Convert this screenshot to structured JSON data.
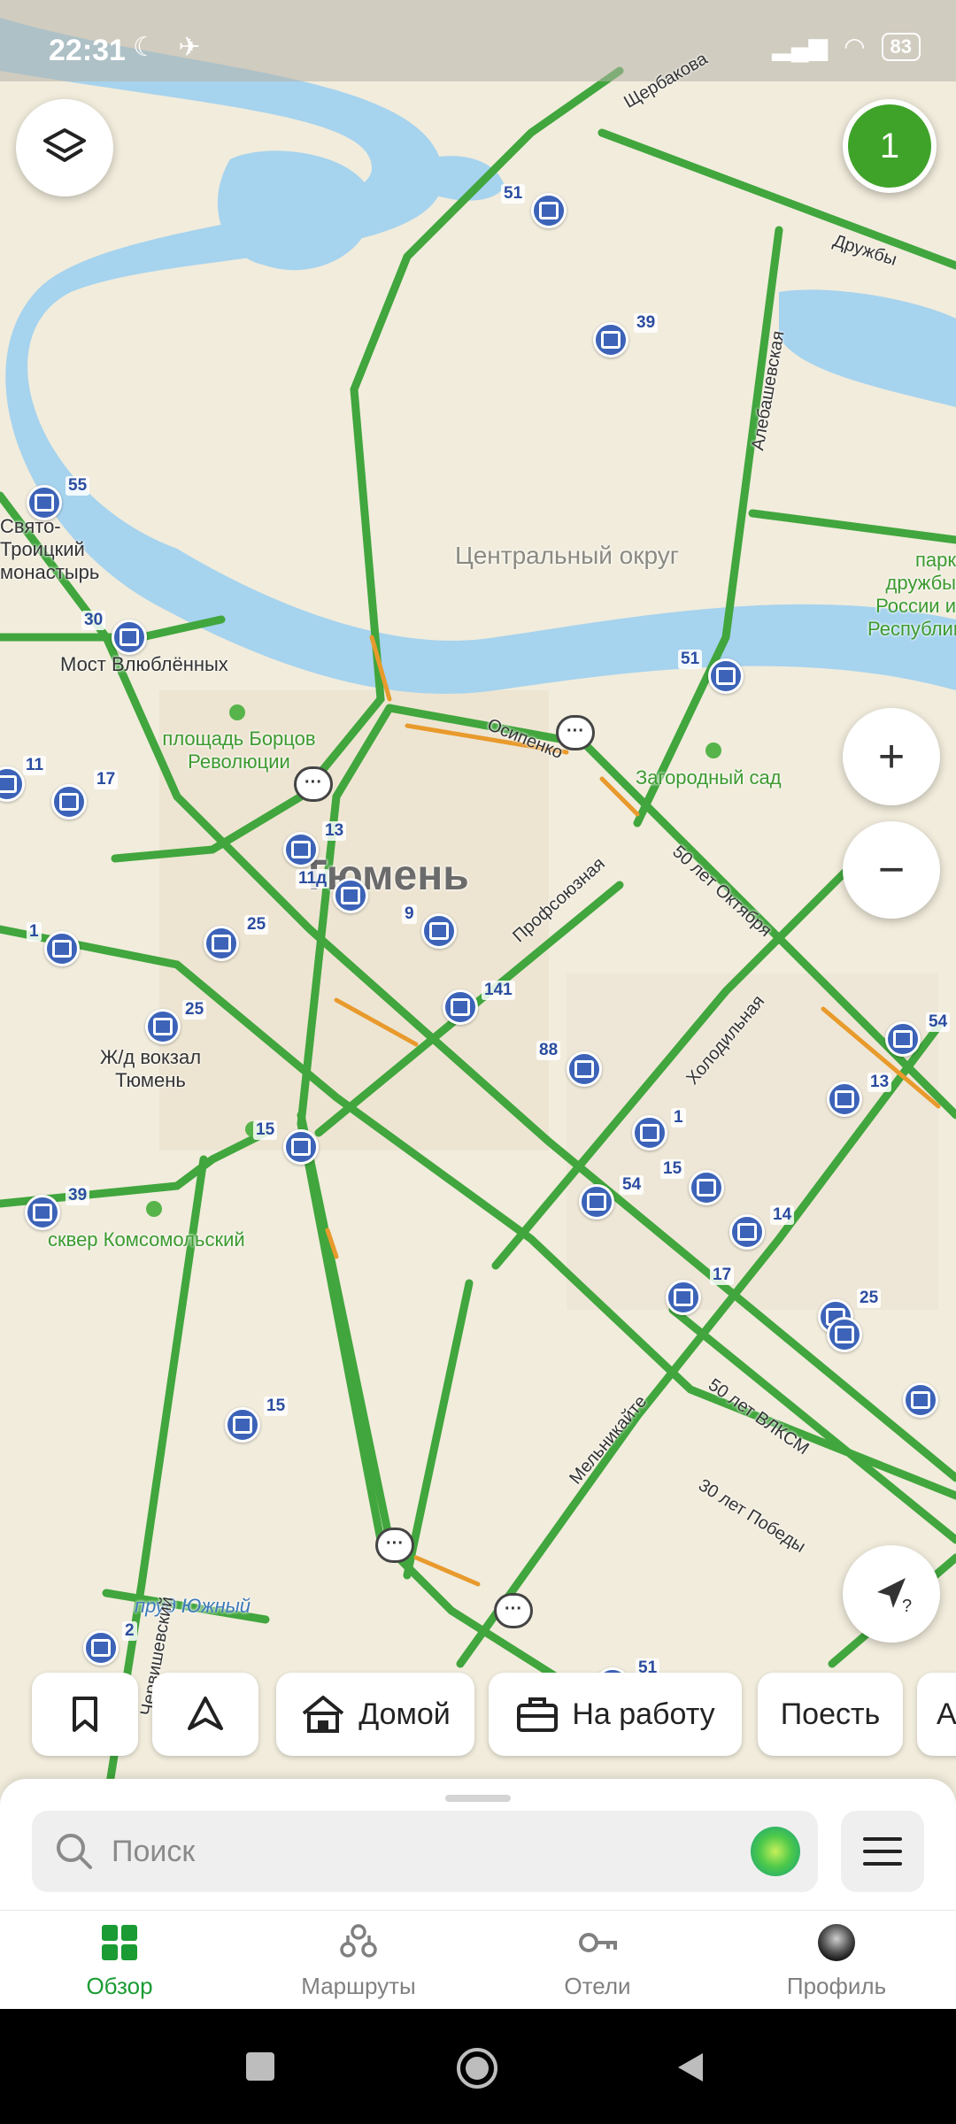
{
  "status_bar": {
    "time": "22:31",
    "battery": "83"
  },
  "notifications": {
    "count": "1"
  },
  "map": {
    "labels": {
      "district": "Центральный округ",
      "city": "Тюмень",
      "bridge": "Мост Влюблённых",
      "square": "площадь Борцов Революции",
      "garden": "Загородный сад",
      "station": "Ж/д вокзал Тюмень",
      "skver": "сквер Комсомольский",
      "pond": "пруд Южный",
      "monastery": "Свято-Троицкий монастырь",
      "park_right": "парк дружбы России и Республики",
      "street_shcherbakova": "Щербакова",
      "street_druzhby": "Дружбы",
      "street_alebashevskaya": "Алебашевская",
      "street_osipenko": "Осипенко",
      "street_50let_oktyabrya": "50 лет Октября",
      "street_profsoyuznaya": "Профсоюзная",
      "street_holodilnaya": "Холодильная",
      "street_melnikaite": "Мельникайте",
      "street_50let_vlksm": "50 лет ВЛКСМ",
      "street_30let_pobedy": "30 лет Победы",
      "street_chervishevsky": "Червишевский"
    },
    "stops": [
      "51",
      "39",
      "55",
      "30",
      "51",
      "11",
      "17",
      "13",
      "11д",
      "9",
      "25",
      "1",
      "25",
      "141",
      "88",
      "1",
      "15",
      "54",
      "15",
      "39",
      "54",
      "13",
      "14",
      "17",
      "25",
      "15",
      "51",
      "2"
    ]
  },
  "chips": [
    {
      "label": "Домой"
    },
    {
      "label": "На работу"
    },
    {
      "label": "Поесть"
    },
    {
      "label": "А"
    }
  ],
  "search": {
    "placeholder": "Поиск"
  },
  "tabs": [
    {
      "label": "Обзор"
    },
    {
      "label": "Маршруты"
    },
    {
      "label": "Отели"
    },
    {
      "label": "Профиль"
    }
  ]
}
